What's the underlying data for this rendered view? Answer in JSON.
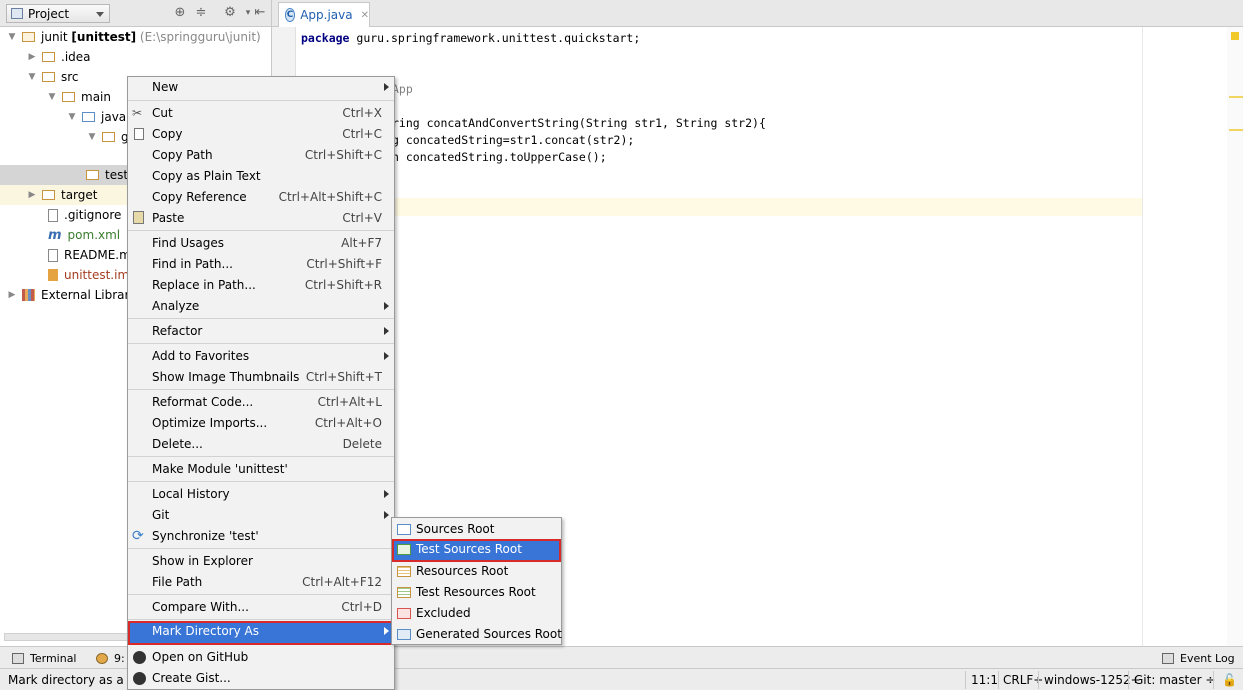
{
  "project_panel": {
    "view_label": "Project",
    "tree": [
      {
        "label": "junit",
        "bold": "[unittest]",
        "extra": "(E:\\springguru\\junit)"
      },
      {
        "label": ".idea"
      },
      {
        "label": "src"
      },
      {
        "label": "main"
      },
      {
        "label": "java"
      },
      {
        "label": "g"
      },
      {
        "label": "test"
      },
      {
        "label": "target"
      },
      {
        "label": ".gitignore"
      },
      {
        "label": "pom.xml"
      },
      {
        "label": "README.md"
      },
      {
        "label": "unittest.iml"
      },
      {
        "label": "External Libraries"
      }
    ]
  },
  "editor": {
    "tab_label": "App.java",
    "lines": [
      {
        "kw": "package",
        "text": " guru.springframework.unittest.quickstart;"
      },
      {
        "text": "App"
      },
      {
        "text": "ring concatAndConvertString(String str1, String str2){"
      },
      {
        "text": "g concatedString=str1.concat(str2);"
      },
      {
        "text": "n concatedString.toUpperCase();"
      }
    ]
  },
  "context_menu": {
    "items": [
      {
        "label": "New",
        "shortcut": ""
      },
      {
        "label": "Cut",
        "shortcut": "Ctrl+X"
      },
      {
        "label": "Copy",
        "shortcut": "Ctrl+C"
      },
      {
        "label": "Copy Path",
        "shortcut": "Ctrl+Shift+C"
      },
      {
        "label": "Copy as Plain Text",
        "shortcut": ""
      },
      {
        "label": "Copy Reference",
        "shortcut": "Ctrl+Alt+Shift+C"
      },
      {
        "label": "Paste",
        "shortcut": "Ctrl+V"
      },
      {
        "label": "Find Usages",
        "shortcut": "Alt+F7"
      },
      {
        "label": "Find in Path...",
        "shortcut": "Ctrl+Shift+F"
      },
      {
        "label": "Replace in Path...",
        "shortcut": "Ctrl+Shift+R"
      },
      {
        "label": "Analyze",
        "shortcut": ""
      },
      {
        "label": "Refactor",
        "shortcut": ""
      },
      {
        "label": "Add to Favorites",
        "shortcut": ""
      },
      {
        "label": "Show Image Thumbnails",
        "shortcut": "Ctrl+Shift+T"
      },
      {
        "label": "Reformat Code...",
        "shortcut": "Ctrl+Alt+L"
      },
      {
        "label": "Optimize Imports...",
        "shortcut": "Ctrl+Alt+O"
      },
      {
        "label": "Delete...",
        "shortcut": "Delete"
      },
      {
        "label": "Make Module 'unittest'",
        "shortcut": ""
      },
      {
        "label": "Local History",
        "shortcut": ""
      },
      {
        "label": "Git",
        "shortcut": ""
      },
      {
        "label": "Synchronize 'test'",
        "shortcut": ""
      },
      {
        "label": "Show in Explorer",
        "shortcut": ""
      },
      {
        "label": "File Path",
        "shortcut": "Ctrl+Alt+F12"
      },
      {
        "label": "Compare With...",
        "shortcut": "Ctrl+D"
      },
      {
        "label": "Mark Directory As",
        "shortcut": ""
      },
      {
        "label": "Open on GitHub",
        "shortcut": ""
      },
      {
        "label": "Create Gist...",
        "shortcut": ""
      }
    ]
  },
  "submenu": {
    "items": [
      {
        "label": "Sources Root",
        "color": "#5b8dc9"
      },
      {
        "label": "Test Sources Root",
        "color": "#4e9a3e"
      },
      {
        "label": "Resources Root",
        "color": "#c7943f"
      },
      {
        "label": "Test Resources Root",
        "color": "#c7943f"
      },
      {
        "label": "Excluded",
        "color": "#d9534f"
      },
      {
        "label": "Generated Sources Root",
        "color": "#5b8dc9"
      }
    ]
  },
  "bottom_toolbar": {
    "terminal": "Terminal",
    "version_control": "9:",
    "event_log": "Event Log"
  },
  "status_bar": {
    "message": "Mark directory as a Tes",
    "position": "11:1",
    "line_sep": "CRLF÷",
    "encoding": "windows-1252÷",
    "vcs": "Git: master ÷"
  },
  "colors": {
    "accent": "#3875d7",
    "highlight_border": "#d92a2a"
  }
}
